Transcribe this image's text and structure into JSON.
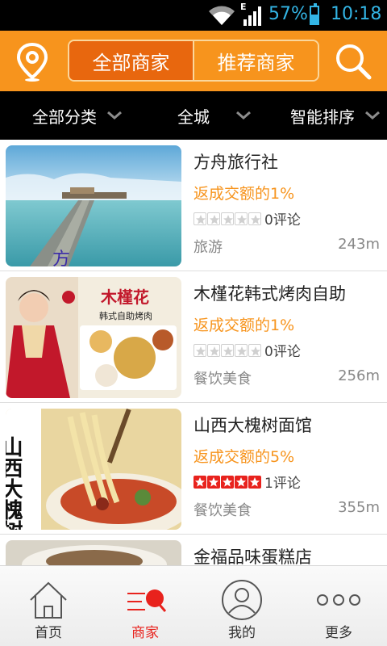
{
  "status_bar": {
    "network": "E",
    "battery_percent": "57%",
    "battery_level": 0.57,
    "time": "10:18",
    "icons": [
      "wifi-icon",
      "signal-icon",
      "battery-icon"
    ]
  },
  "header": {
    "location_icon": "location-pin-icon",
    "segments": [
      "全部商家",
      "推荐商家"
    ],
    "active_segment": 0,
    "search_icon": "search-icon",
    "colors": {
      "bar": "#f7941d",
      "active": "#e8670e"
    }
  },
  "filters": [
    {
      "label": "全部分类"
    },
    {
      "label": "全城"
    },
    {
      "label": "智能排序"
    }
  ],
  "merchants": [
    {
      "name": "方舟旅行社",
      "rebate": "返成交额的1%",
      "stars": 0,
      "review_count": "0评论",
      "category": "旅游",
      "distance": "243m",
      "thumb": "travel-pier-image"
    },
    {
      "name": "木槿花韩式烤肉自助",
      "rebate": "返成交额的1%",
      "stars": 0,
      "review_count": "0评论",
      "category": "餐饮美食",
      "distance": "256m",
      "thumb": "korean-bbq-image"
    },
    {
      "name": "山西大槐树面馆",
      "rebate": "返成交额的5%",
      "stars": 5,
      "review_count": "1评论",
      "category": "餐饮美食",
      "distance": "355m",
      "thumb": "noodle-image"
    },
    {
      "name": "金福品味蛋糕店",
      "rebate": "",
      "stars": 0,
      "review_count": "",
      "category": "",
      "distance": "",
      "thumb": "cake-image"
    }
  ],
  "thumb_text": {
    "travel": "方",
    "bbq_title": "木槿花",
    "bbq_sub": "韩式自助烤肉",
    "noodle": "山西大槐树"
  },
  "tabbar": {
    "tabs": [
      {
        "label": "首页",
        "icon": "home-icon"
      },
      {
        "label": "商家",
        "icon": "merchant-icon"
      },
      {
        "label": "我的",
        "icon": "user-icon"
      },
      {
        "label": "更多",
        "icon": "more-icon"
      }
    ],
    "active_tab": 1,
    "accent": "#e8221d"
  }
}
